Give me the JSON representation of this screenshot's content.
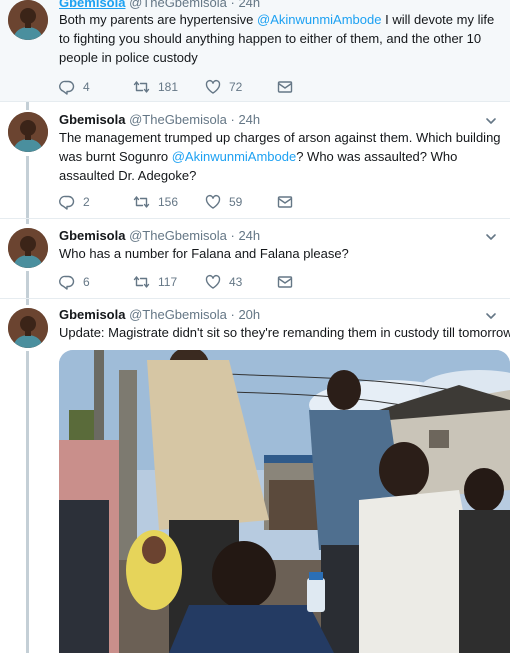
{
  "tweets": [
    {
      "name": "Gbemisola",
      "handle": "@TheGbemisola",
      "dot": "·",
      "time": "24h",
      "text_parts": [
        "Both my parents are hypertensive ",
        "@AkinwunmiAmbode",
        " I will devote my life to fighting you should anything happen to either of them, and the other 10 people in police custody"
      ],
      "replies": "4",
      "retweets": "181",
      "likes": "72"
    },
    {
      "name": "Gbemisola",
      "handle": "@TheGbemisola",
      "dot": "·",
      "time": "24h",
      "text_parts": [
        "The management trumped up charges of arson against them. Which building was burnt Sogunro ",
        "@AkinwunmiAmbode",
        "? Who was assaulted? Who assaulted Dr. Adegoke?"
      ],
      "replies": "2",
      "retweets": "156",
      "likes": "59"
    },
    {
      "name": "Gbemisola",
      "handle": "@TheGbemisola",
      "dot": "·",
      "time": "24h",
      "text": "Who has a number for Falana and Falana please?",
      "replies": "6",
      "retweets": "117",
      "likes": "43"
    },
    {
      "name": "Gbemisola",
      "handle": "@TheGbemisola",
      "dot": "·",
      "time": "20h",
      "text": "Update: Magistrate didn't sit so they're remanding them in custody till tomorrow."
    }
  ],
  "icons": {
    "reply": "reply-icon",
    "retweet": "retweet-icon",
    "like": "heart-icon",
    "dm": "envelope-icon",
    "caret": "chevron-down-icon"
  },
  "colors": {
    "link": "#1da1f2",
    "secondary_text": "#657786",
    "first_tweet_bg": "#f5f8fa"
  }
}
